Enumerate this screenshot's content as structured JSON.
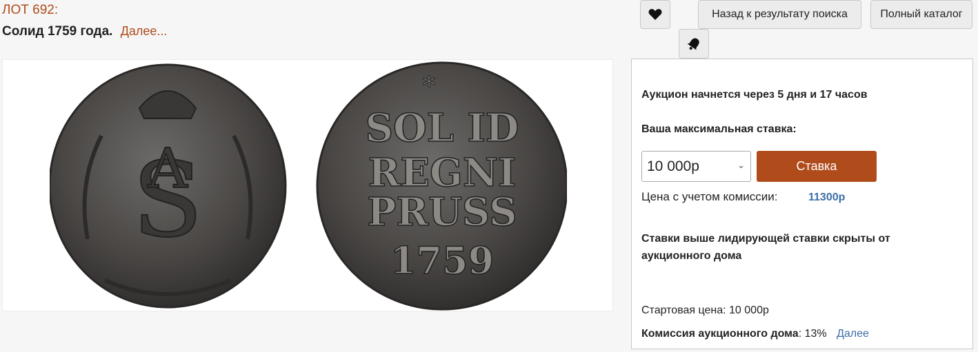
{
  "lot": {
    "number_label": "ЛОТ 692:",
    "title": "Солид 1759 года.",
    "more_link": "Далее..."
  },
  "toolbar": {
    "back_label": "Назад к результату поиска",
    "catalog_label": "Полный каталог"
  },
  "images": {
    "coin_obverse_text": "SOL ID REGNI PRUSS 1759"
  },
  "panel": {
    "auction_starts": "Аукцион начнется через 5 дня и 17 часов",
    "max_bid_label": "Ваша максимальная ставка:",
    "bid_value": "10 000р",
    "bid_button": "Ставка",
    "price_with_commission_label": "Цена с учетом комиссии:",
    "price_with_commission_value": "11300р",
    "hidden_bids_note": "Ставки выше лидирующей ставки скрыты от аукционного дома",
    "start_price": "Стартовая цена: 10 000р",
    "commission_label": "Комиссия аукционного дома",
    "commission_value": ": 13%",
    "commission_more": "Далее"
  },
  "colors": {
    "accent": "#b04c1c",
    "link_blue": "#3b6ea8"
  }
}
